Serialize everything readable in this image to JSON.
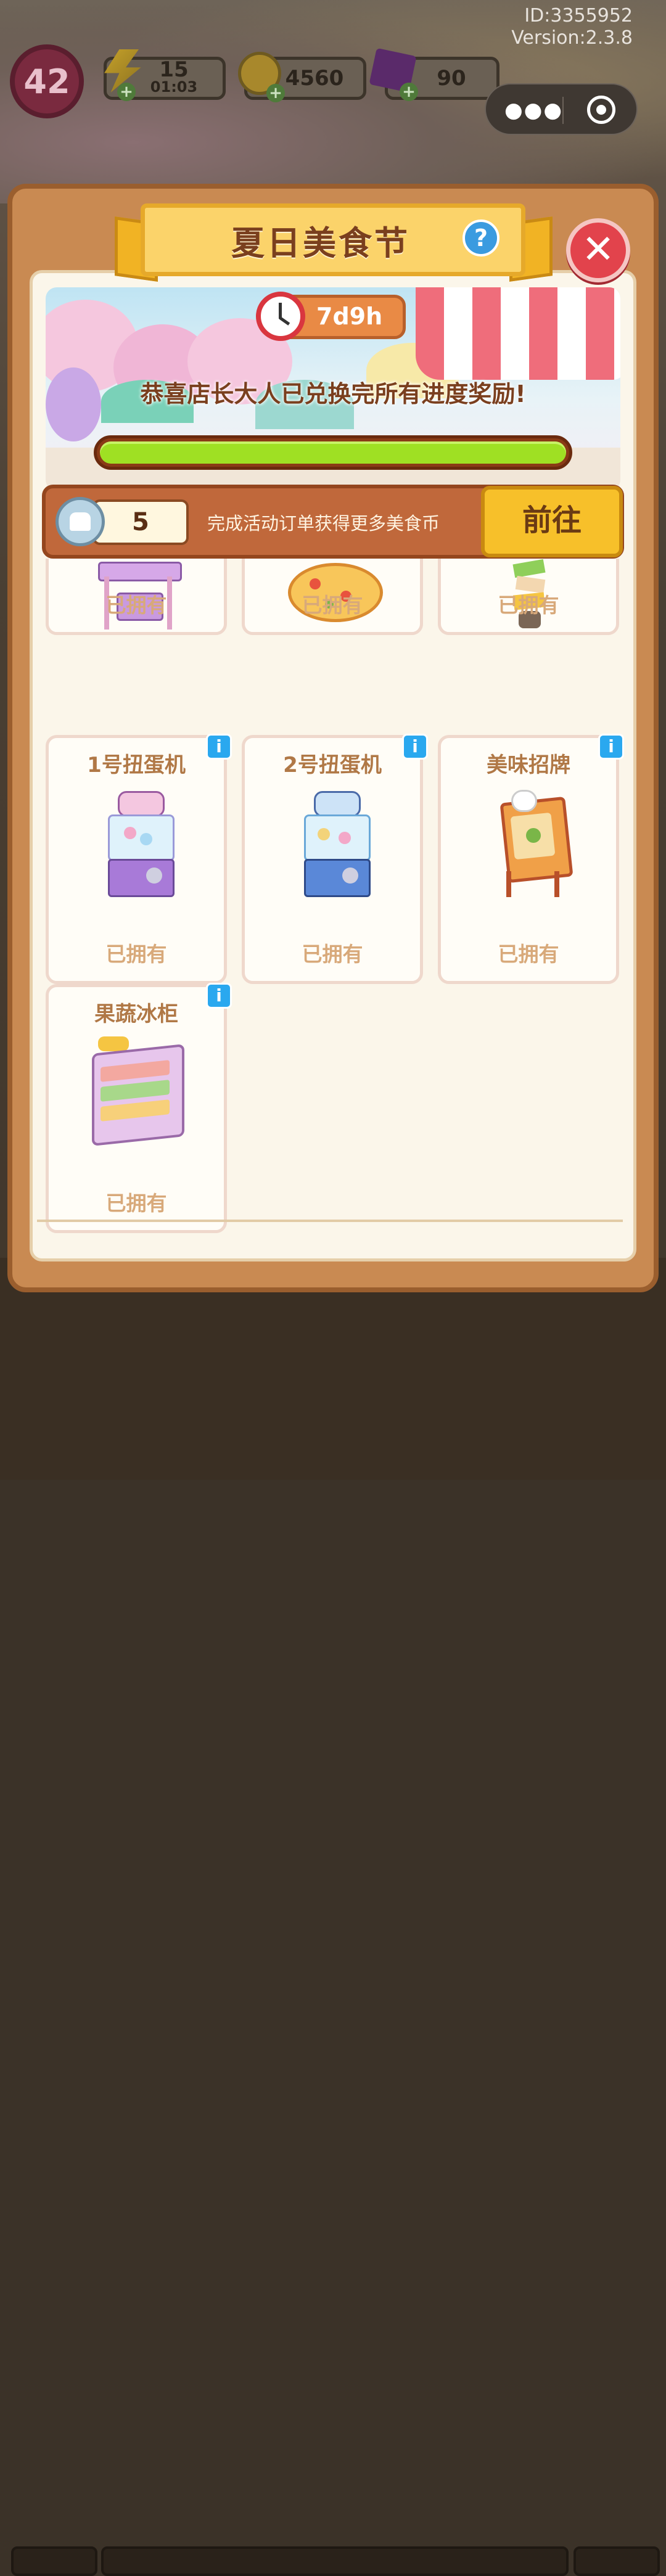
{
  "header": {
    "id_text": "ID:3355952",
    "version_text": "Version:2.3.8",
    "level": "42",
    "energy": {
      "value": "15",
      "timer": "01:03"
    },
    "coins": "4560",
    "gems": "90"
  },
  "event": {
    "title": "夏日美食节",
    "countdown": "7d9h",
    "congrats": "恭喜店长大人已兑换完所有进度奖励!",
    "progress": 1.0
  },
  "currency": {
    "amount": "5",
    "description": "完成活动订单获得更多美食币",
    "go_label": "前往"
  },
  "items_top_row": [
    {
      "status": "已拥有",
      "icon": "swing-chair-icon"
    },
    {
      "status": "已拥有",
      "icon": "pizza-icon"
    },
    {
      "status": "已拥有",
      "icon": "food-sign-tower-icon"
    }
  ],
  "items": [
    {
      "name": "1号扭蛋机",
      "status": "已拥有",
      "icon": "gacha-machine-purple-icon"
    },
    {
      "name": "2号扭蛋机",
      "status": "已拥有",
      "icon": "gacha-machine-blue-icon"
    },
    {
      "name": "美味招牌",
      "status": "已拥有",
      "icon": "signboard-icon"
    },
    {
      "name": "果蔬冰柜",
      "status": "已拥有",
      "icon": "fridge-display-icon"
    }
  ],
  "colors": {
    "panel": "#c98a52",
    "banner": "#fbd36a",
    "progress": "#9fe023",
    "close": "#e2434c",
    "info": "#2aa8ef"
  }
}
